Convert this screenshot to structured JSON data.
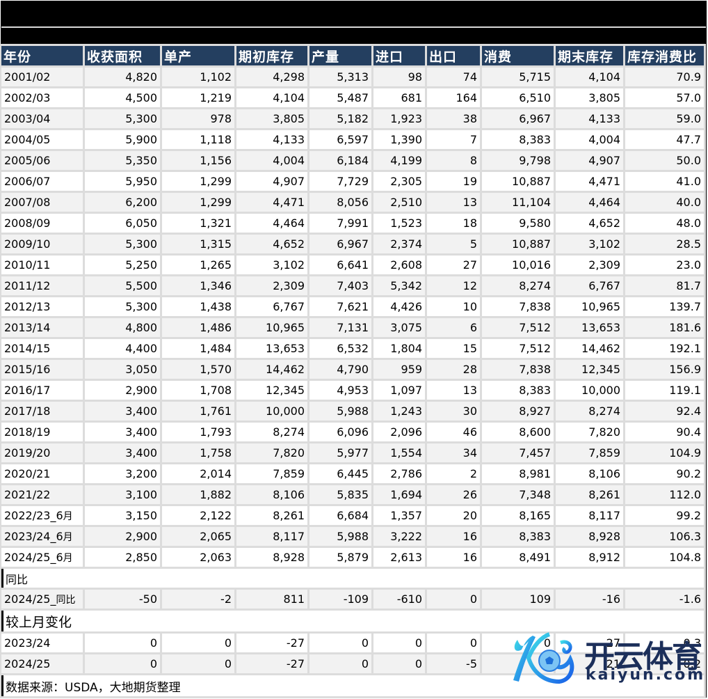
{
  "table": {
    "headers": [
      "年份",
      "收获面积",
      "单产",
      "期初库存",
      "产量",
      "进口",
      "出口",
      "消费",
      "期末库存",
      "库存消费比"
    ],
    "rows": [
      [
        "2001/02",
        "4,820",
        "1,102",
        "4,298",
        "5,313",
        "98",
        "74",
        "5,715",
        "4,104",
        "70.9"
      ],
      [
        "2002/03",
        "4,500",
        "1,219",
        "4,104",
        "5,487",
        "681",
        "164",
        "6,510",
        "3,805",
        "57.0"
      ],
      [
        "2003/04",
        "5,300",
        "978",
        "3,805",
        "5,182",
        "1,923",
        "38",
        "6,967",
        "4,133",
        "59.0"
      ],
      [
        "2004/05",
        "5,900",
        "1,118",
        "4,133",
        "6,597",
        "1,390",
        "7",
        "8,383",
        "4,004",
        "47.7"
      ],
      [
        "2005/06",
        "5,350",
        "1,156",
        "4,004",
        "6,184",
        "4,199",
        "8",
        "9,798",
        "4,907",
        "50.0"
      ],
      [
        "2006/07",
        "5,950",
        "1,299",
        "4,907",
        "7,729",
        "2,305",
        "19",
        "10,887",
        "4,471",
        "41.0"
      ],
      [
        "2007/08",
        "6,200",
        "1,299",
        "4,471",
        "8,056",
        "2,510",
        "13",
        "11,104",
        "4,464",
        "40.0"
      ],
      [
        "2008/09",
        "6,050",
        "1,321",
        "4,464",
        "7,991",
        "1,523",
        "18",
        "9,580",
        "4,652",
        "48.0"
      ],
      [
        "2009/10",
        "5,300",
        "1,315",
        "4,652",
        "6,967",
        "2,374",
        "5",
        "10,887",
        "3,102",
        "28.5"
      ],
      [
        "2010/11",
        "5,250",
        "1,265",
        "3,102",
        "6,641",
        "2,608",
        "27",
        "10,016",
        "2,309",
        "23.0"
      ],
      [
        "2011/12",
        "5,500",
        "1,346",
        "2,309",
        "7,403",
        "5,342",
        "12",
        "8,274",
        "6,767",
        "81.7"
      ],
      [
        "2012/13",
        "5,300",
        "1,438",
        "6,767",
        "7,621",
        "4,426",
        "10",
        "7,838",
        "10,965",
        "139.7"
      ],
      [
        "2013/14",
        "4,800",
        "1,486",
        "10,965",
        "7,131",
        "3,075",
        "6",
        "7,512",
        "13,653",
        "181.6"
      ],
      [
        "2014/15",
        "4,400",
        "1,484",
        "13,653",
        "6,532",
        "1,804",
        "15",
        "7,512",
        "14,462",
        "192.1"
      ],
      [
        "2015/16",
        "3,050",
        "1,570",
        "14,462",
        "4,790",
        "959",
        "28",
        "7,838",
        "12,345",
        "156.9"
      ],
      [
        "2016/17",
        "2,900",
        "1,708",
        "12,345",
        "4,953",
        "1,097",
        "13",
        "8,383",
        "10,000",
        "119.1"
      ],
      [
        "2017/18",
        "3,400",
        "1,761",
        "10,000",
        "5,988",
        "1,243",
        "30",
        "8,927",
        "8,274",
        "92.4"
      ],
      [
        "2018/19",
        "3,400",
        "1,793",
        "8,274",
        "6,096",
        "2,096",
        "46",
        "8,600",
        "7,820",
        "90.4"
      ],
      [
        "2019/20",
        "3,400",
        "1,758",
        "7,820",
        "5,977",
        "1,554",
        "34",
        "7,457",
        "7,859",
        "104.9"
      ],
      [
        "2020/21",
        "3,200",
        "2,014",
        "7,859",
        "6,445",
        "2,786",
        "2",
        "8,981",
        "8,106",
        "90.2"
      ],
      [
        "2021/22",
        "3,100",
        "1,882",
        "8,106",
        "5,835",
        "1,694",
        "26",
        "7,348",
        "8,261",
        "112.0"
      ],
      [
        "2022/23_6月",
        "3,150",
        "2,122",
        "8,261",
        "6,684",
        "1,357",
        "20",
        "8,165",
        "8,117",
        "99.2"
      ],
      [
        "2023/24_6月",
        "2,900",
        "2,065",
        "8,117",
        "5,988",
        "3,222",
        "16",
        "8,383",
        "8,928",
        "106.3"
      ],
      [
        "2024/25_6月",
        "2,850",
        "2,063",
        "8,928",
        "5,879",
        "2,613",
        "16",
        "8,491",
        "8,912",
        "104.8"
      ]
    ],
    "yoy_section_label": "同比",
    "yoy_rows": [
      [
        "2024/25_同比",
        "-50",
        "-2",
        "811",
        "-109",
        "-610",
        "0",
        "109",
        "-16",
        "-1.6"
      ]
    ],
    "mom_section_label": "较上月变化",
    "mom_rows": [
      [
        "2023/24",
        "0",
        "0",
        "-27",
        "0",
        "0",
        "0",
        "0",
        "27",
        "0.3"
      ],
      [
        "2024/25",
        "0",
        "0",
        "-27",
        "0",
        "0",
        "-5",
        "0",
        "21",
        "0.2"
      ]
    ],
    "source_note": "数据来源：USDA，大地期货整理"
  },
  "watermark": {
    "brand_cn": "开云体育",
    "brand_en": "kaiyun.com"
  },
  "colors": {
    "header_bg": "#243f60",
    "header_text": "#ffffff",
    "row_alt_bg": "#f2f2f2",
    "grid_line": "#dcdcdc",
    "watermark_text": "#1c2f5a"
  }
}
